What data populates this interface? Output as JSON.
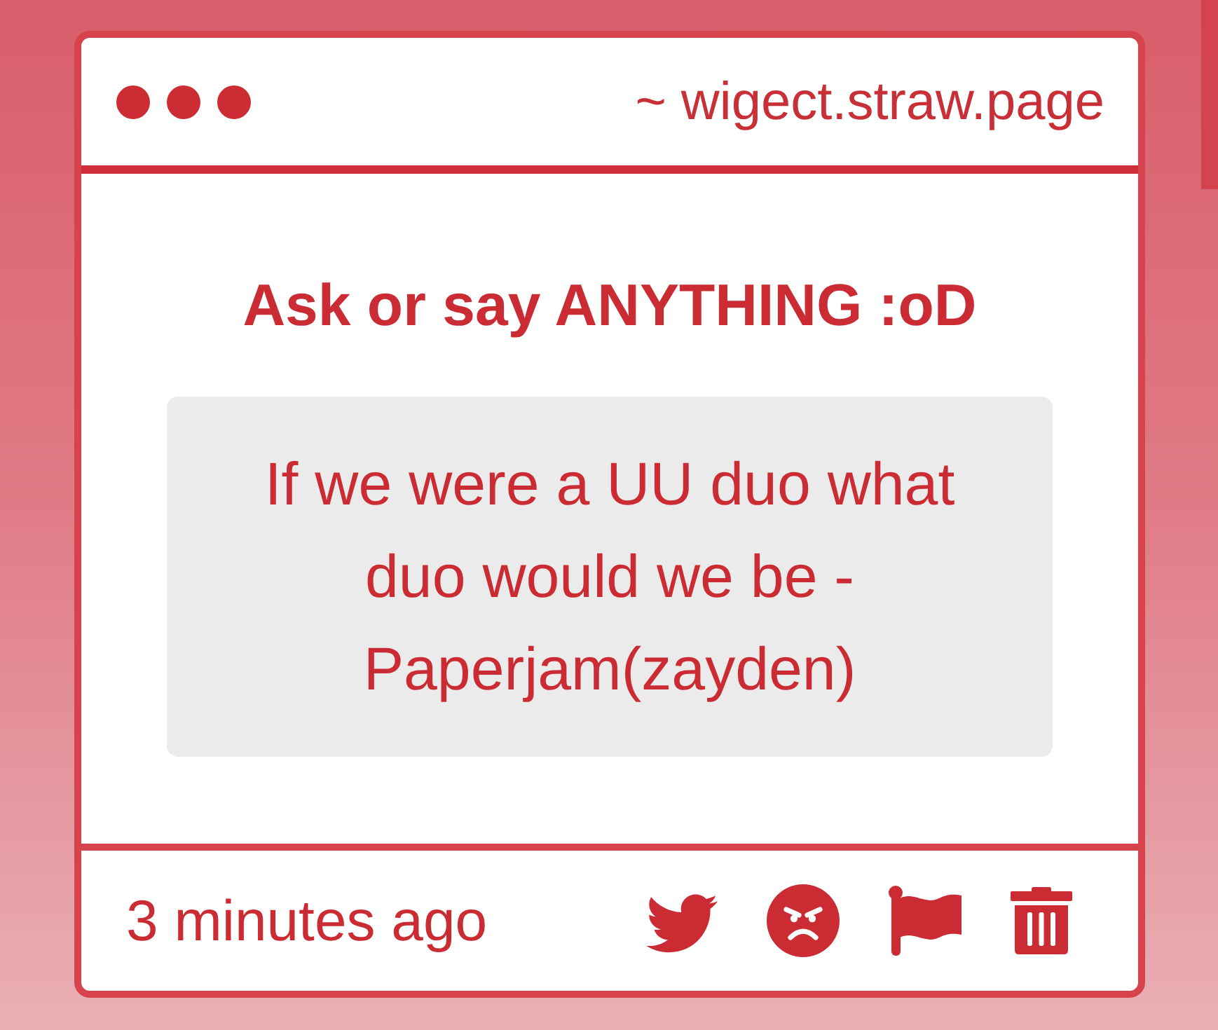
{
  "window": {
    "address": "~ wigect.straw.page"
  },
  "question": {
    "heading": "Ask or say ANYTHING :oD",
    "message": "If we were a UU duo what duo would we be - Paperjam(zayden)"
  },
  "footer": {
    "time": "3 minutes ago"
  }
}
